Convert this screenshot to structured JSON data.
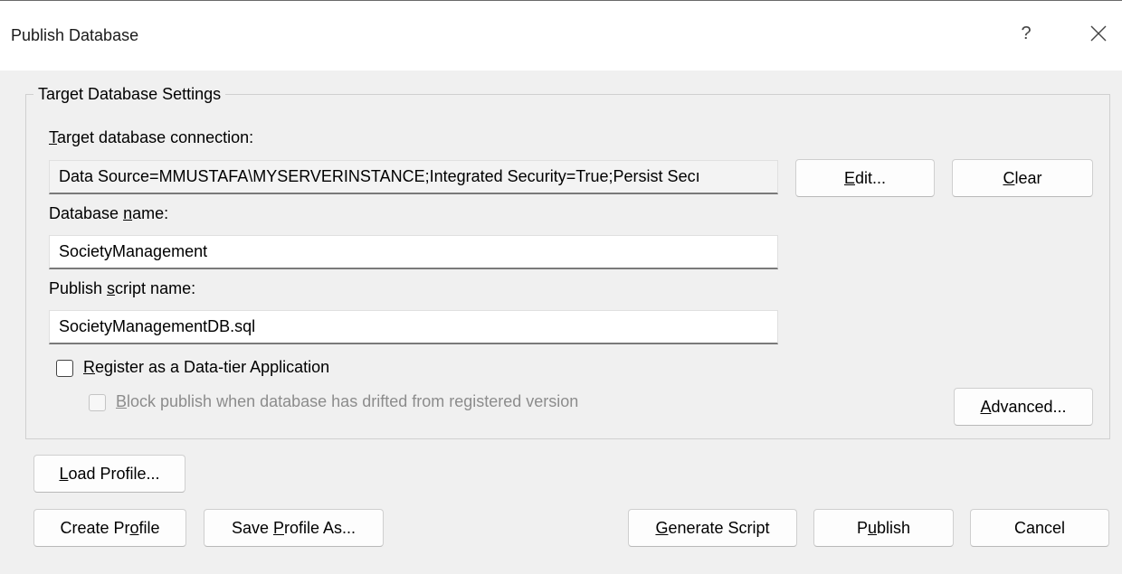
{
  "window": {
    "title": "Publish Database",
    "help_symbol": "?"
  },
  "target_settings": {
    "legend": "Target Database Settings",
    "connection": {
      "label_mnemonic": "T",
      "label_rest": "arget database connection:",
      "value": "Data Source=MMUSTAFA\\MYSERVERINSTANCE;Integrated Security=True;Persist Secı"
    },
    "edit_button": {
      "mnemonic": "E",
      "rest": "dit..."
    },
    "clear_button": {
      "mnemonic": "C",
      "rest": "lear"
    },
    "database_name": {
      "label_before": "Database ",
      "label_mnemonic": "n",
      "label_after": "ame:",
      "value": "SocietyManagement"
    },
    "script_name": {
      "label_before": "Publish ",
      "label_mnemonic": "s",
      "label_after": "cript name:",
      "value": "SocietyManagementDB.sql"
    },
    "register_checkbox": {
      "mnemonic": "R",
      "rest": "egister as a Data-tier Application",
      "checked": false
    },
    "block_checkbox": {
      "mnemonic": "B",
      "rest": "lock publish when database has drifted from registered version",
      "checked": false,
      "enabled": false
    },
    "advanced_button": {
      "mnemonic": "A",
      "rest": "dvanced..."
    }
  },
  "footer": {
    "load_profile": {
      "mnemonic": "L",
      "rest": "oad Profile..."
    },
    "create_profile": {
      "before": "Create Pr",
      "mnemonic": "o",
      "after": "file"
    },
    "save_profile_as": {
      "before": "Save ",
      "mnemonic": "P",
      "after": "rofile As..."
    },
    "generate_script": {
      "mnemonic": "G",
      "rest": "enerate Script"
    },
    "publish": {
      "before": "P",
      "mnemonic": "u",
      "after": "blish"
    },
    "cancel": {
      "label": "Cancel"
    }
  }
}
